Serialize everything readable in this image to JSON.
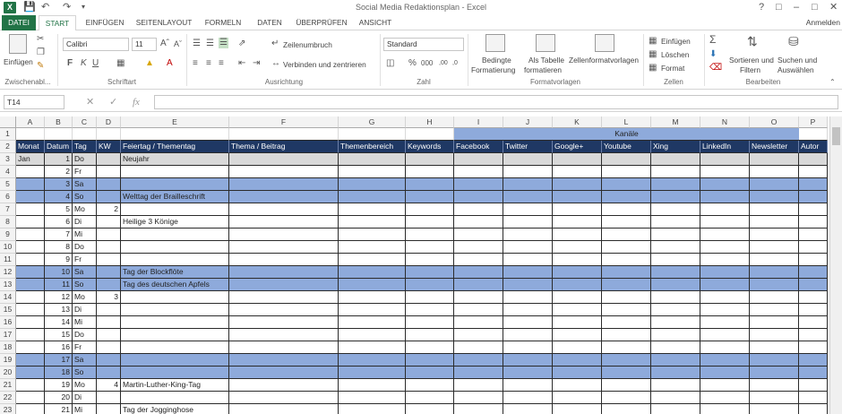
{
  "window": {
    "title": "Social Media Redaktionsplan - Excel",
    "signin": "Anmelden"
  },
  "tabs": [
    "DATEI",
    "START",
    "EINFÜGEN",
    "SEITENLAYOUT",
    "FORMELN",
    "DATEN",
    "ÜBERPRÜFEN",
    "ANSICHT"
  ],
  "ribbon": {
    "clipboard": {
      "paste": "Einfügen",
      "label": "Zwischenabl..."
    },
    "font": {
      "name": "Calibri",
      "size": "11",
      "label": "Schriftart"
    },
    "alignment": {
      "wrap": "Zeilenumbruch",
      "merge": "Verbinden und zentrieren",
      "label": "Ausrichtung"
    },
    "number": {
      "format": "Standard",
      "label": "Zahl"
    },
    "styles": {
      "conditional": "Bedingte\nFormatierung",
      "cond1": "Bedingte",
      "cond2": "Formatierung",
      "table1": "Als Tabelle",
      "table2": "formatieren",
      "cellstyles": "Zellenformatvorlagen",
      "label": "Formatvorlagen"
    },
    "cells": {
      "insert": "Einfügen",
      "delete": "Löschen",
      "format": "Format",
      "label": "Zellen"
    },
    "editing": {
      "sort1": "Sortieren und",
      "sort2": "Filtern",
      "find1": "Suchen und",
      "find2": "Auswählen",
      "label": "Bearbeiten"
    }
  },
  "formula_bar": {
    "namebox": "T14",
    "fx": "fx",
    "value": ""
  },
  "columns": [
    "A",
    "B",
    "C",
    "D",
    "E",
    "F",
    "G",
    "H",
    "I",
    "J",
    "K",
    "L",
    "M",
    "N",
    "O",
    "P"
  ],
  "kanale": "Kanäle",
  "headers": [
    "Monat",
    "Datum",
    "Tag",
    "KW",
    "Feiertag / Thementag",
    "Thema / Beitrag",
    "Themenbereich",
    "Keywords",
    "Facebook",
    "Twitter",
    "Google+",
    "Youtube",
    "Xing",
    "LinkedIn",
    "Newsletter",
    "Autor"
  ],
  "rows": [
    {
      "num": "3",
      "month": "Jan",
      "date": "1",
      "day": "Do",
      "kw": "",
      "event": "Neujahr",
      "style": "gray"
    },
    {
      "num": "4",
      "month": "",
      "date": "2",
      "day": "Fr",
      "kw": "",
      "event": "",
      "style": ""
    },
    {
      "num": "5",
      "month": "",
      "date": "3",
      "day": "Sa",
      "kw": "",
      "event": "",
      "style": "blue"
    },
    {
      "num": "6",
      "month": "",
      "date": "4",
      "day": "So",
      "kw": "",
      "event": "Welttag der Brailleschrift",
      "style": "blue"
    },
    {
      "num": "7",
      "month": "",
      "date": "5",
      "day": "Mo",
      "kw": "2",
      "event": "",
      "style": ""
    },
    {
      "num": "8",
      "month": "",
      "date": "6",
      "day": "Di",
      "kw": "",
      "event": "Heilige 3 Könige",
      "style": ""
    },
    {
      "num": "9",
      "month": "",
      "date": "7",
      "day": "Mi",
      "kw": "",
      "event": "",
      "style": ""
    },
    {
      "num": "10",
      "month": "",
      "date": "8",
      "day": "Do",
      "kw": "",
      "event": "",
      "style": ""
    },
    {
      "num": "11",
      "month": "",
      "date": "9",
      "day": "Fr",
      "kw": "",
      "event": "",
      "style": ""
    },
    {
      "num": "12",
      "month": "",
      "date": "10",
      "day": "Sa",
      "kw": "",
      "event": "Tag der Blockflöte",
      "style": "blue"
    },
    {
      "num": "13",
      "month": "",
      "date": "11",
      "day": "So",
      "kw": "",
      "event": "Tag des deutschen Apfels",
      "style": "blue"
    },
    {
      "num": "14",
      "month": "",
      "date": "12",
      "day": "Mo",
      "kw": "3",
      "event": "",
      "style": ""
    },
    {
      "num": "15",
      "month": "",
      "date": "13",
      "day": "Di",
      "kw": "",
      "event": "",
      "style": ""
    },
    {
      "num": "16",
      "month": "",
      "date": "14",
      "day": "Mi",
      "kw": "",
      "event": "",
      "style": ""
    },
    {
      "num": "17",
      "month": "",
      "date": "15",
      "day": "Do",
      "kw": "",
      "event": "",
      "style": ""
    },
    {
      "num": "18",
      "month": "",
      "date": "16",
      "day": "Fr",
      "kw": "",
      "event": "",
      "style": ""
    },
    {
      "num": "19",
      "month": "",
      "date": "17",
      "day": "Sa",
      "kw": "",
      "event": "",
      "style": "blue"
    },
    {
      "num": "20",
      "month": "",
      "date": "18",
      "day": "So",
      "kw": "",
      "event": "",
      "style": "blue"
    },
    {
      "num": "21",
      "month": "",
      "date": "19",
      "day": "Mo",
      "kw": "4",
      "event": "Martin-Luther-King-Tag",
      "style": ""
    },
    {
      "num": "22",
      "month": "",
      "date": "20",
      "day": "Di",
      "kw": "",
      "event": "",
      "style": ""
    },
    {
      "num": "23",
      "month": "",
      "date": "21",
      "day": "Mi",
      "kw": "",
      "event": "Tag der Jogginghose",
      "style": ""
    }
  ]
}
